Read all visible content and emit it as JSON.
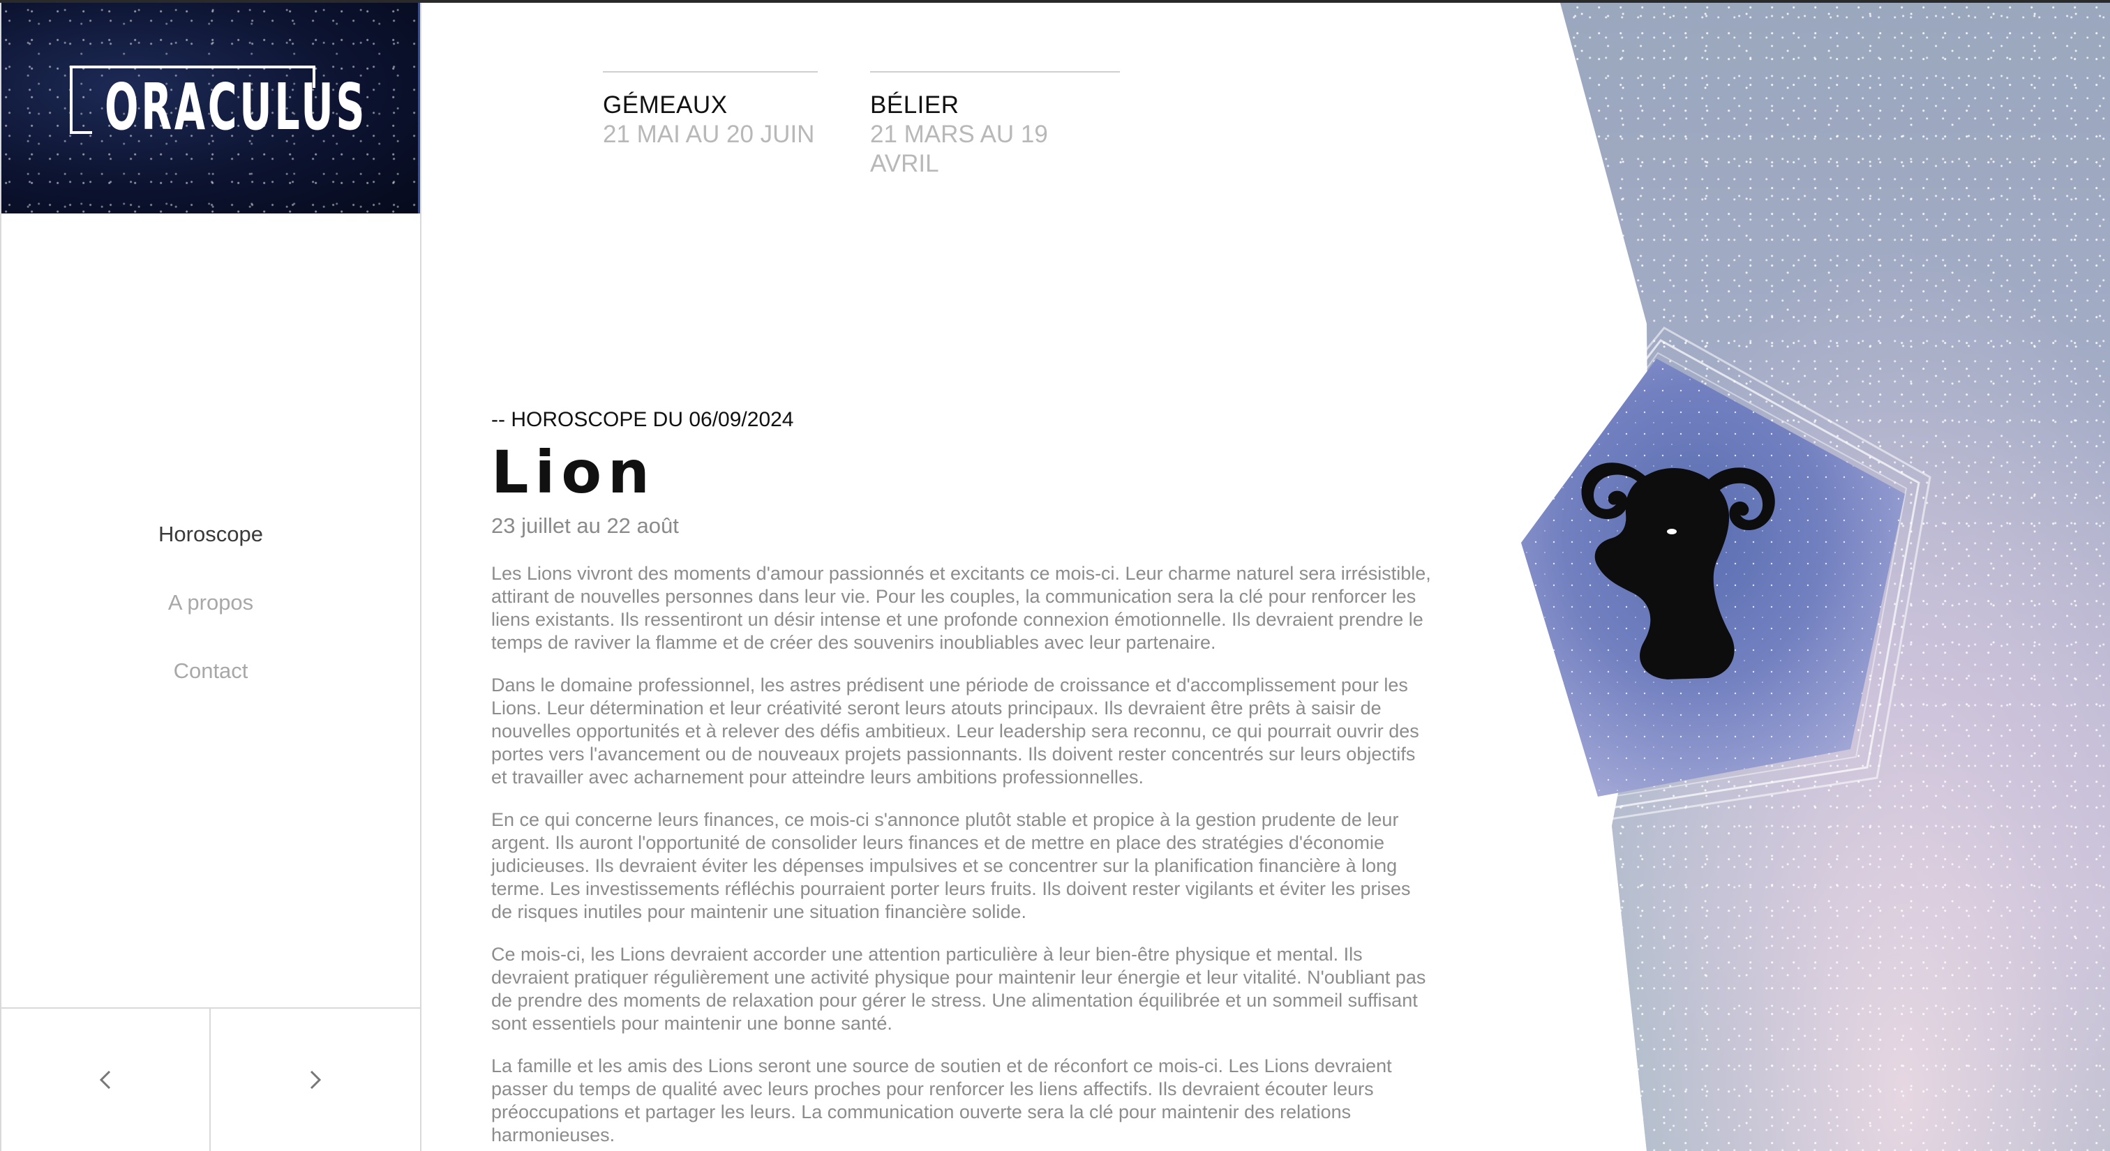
{
  "brand": {
    "logo_text": "ORACULUS"
  },
  "nav": {
    "items": [
      {
        "label": "Horoscope",
        "active": true
      },
      {
        "label": "A propos",
        "active": false
      },
      {
        "label": "Contact",
        "active": false
      }
    ]
  },
  "pager": {
    "prev_icon": "chevron-left-icon",
    "next_icon": "chevron-right-icon"
  },
  "signs_nav": [
    {
      "name": "GÉMEAUX",
      "dates": "21 MAI AU 20 JUIN"
    },
    {
      "name": "BÉLIER",
      "dates": "21 MARS AU 19 AVRIL"
    }
  ],
  "article": {
    "kicker": "-- HOROSCOPE DU 06/09/2024",
    "title": "Lion",
    "subtitle": "23 juillet au 22 août",
    "paragraphs": [
      "Les Lions vivront des moments d'amour passionnés et excitants ce mois-ci. Leur charme naturel sera irrésistible, attirant de nouvelles personnes dans leur vie. Pour les couples, la communication sera la clé pour renforcer les liens existants. Ils ressentiront un désir intense et une profonde connexion émotionnelle. Ils devraient prendre le temps de raviver la flamme et de créer des souvenirs inoubliables avec leur partenaire.",
      "Dans le domaine professionnel, les astres prédisent une période de croissance et d'accomplissement pour les Lions. Leur détermination et leur créativité seront leurs atouts principaux. Ils devraient être prêts à saisir de nouvelles opportunités et à relever des défis ambitieux. Leur leadership sera reconnu, ce qui pourrait ouvrir des portes vers l'avancement ou de nouveaux projets passionnants. Ils doivent rester concentrés sur leurs objectifs et travailler avec acharnement pour atteindre leurs ambitions professionnelles.",
      "En ce qui concerne leurs finances, ce mois-ci s'annonce plutôt stable et propice à la gestion prudente de leur argent. Ils auront l'opportunité de consolider leurs finances et de mettre en place des stratégies d'économie judicieuses. Ils devraient éviter les dépenses impulsives et se concentrer sur la planification financière à long terme. Les investissements réfléchis pourraient porter leurs fruits. Ils doivent rester vigilants et éviter les prises de risques inutiles pour maintenir une situation financière solide.",
      "Ce mois-ci, les Lions devraient accorder une attention particulière à leur bien-être physique et mental. Ils devraient pratiquer régulièrement une activité physique pour maintenir leur énergie et leur vitalité. N'oubliant pas de prendre des moments de relaxation pour gérer le stress. Une alimentation équilibrée et un sommeil suffisant sont essentiels pour maintenir une bonne santé.",
      "La famille et les amis des Lions seront une source de soutien et de réconfort ce mois-ci. Les Lions devraient passer du temps de qualité avec leurs proches pour renforcer les liens affectifs. Ils devraient écouter leurs préoccupations et partager les leurs. La communication ouverte sera la clé pour maintenir des relations harmonieuses."
    ]
  },
  "emblem": {
    "icon": "ram-head-icon"
  },
  "colors": {
    "accent_border": "#2f4c9e",
    "text_muted": "#8c8c8c"
  }
}
